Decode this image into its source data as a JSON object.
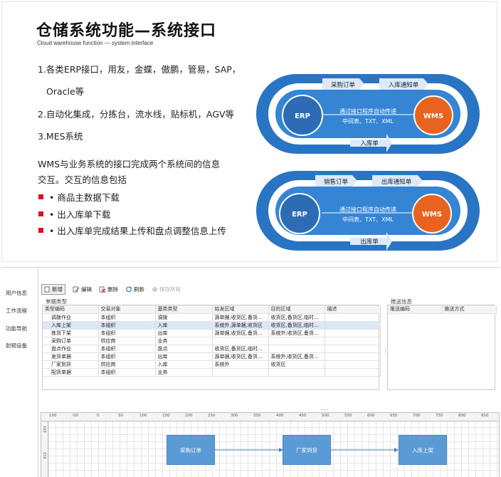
{
  "slide": {
    "title": "仓储系统功能—系统接口",
    "subtitle": "Cloud warehouse function — system interface",
    "lines": [
      "1.各类ERP接口，用友，金蝶，傲鹏，管易，SAP，",
      "Oracle等",
      "2.自动化集成，分拣台，流水线，贴标机，AGV等",
      "3.MES系统",
      "WMS与业务系统的接口完成两个系统间的信息",
      "交互。交互的信息包括"
    ],
    "bullets": [
      "• 商品主数据下载",
      "• 出入库单下载",
      "• 出入库单完成结果上传和盘点调整信息上传"
    ],
    "accent": "#d9121d",
    "diagram1": {
      "top_left": "采购订单",
      "top_right": "入库通知单",
      "left": "ERP",
      "right": "WMS",
      "mid1": "通过接口程序自动传递",
      "mid2": "中间表、TXT、XML",
      "bottom": "入库单"
    },
    "diagram2": {
      "top_left": "销售订单",
      "top_right": "出库通知单",
      "left": "ERP",
      "right": "WMS",
      "mid1": "通过接口程序自动传递",
      "mid2": "中间表、TXT、XML",
      "bottom": "出库单"
    }
  },
  "sidebar": {
    "items": [
      "用户信息",
      "工作流程",
      "功能导航",
      "射频设备"
    ]
  },
  "toolbar": {
    "new": "新增",
    "edit": "编辑",
    "delete": "删除",
    "refresh": "刷新",
    "save_all": "保存所有"
  },
  "panels": {
    "business_type": "单据类型",
    "push_info": "推送信息"
  },
  "table": {
    "headers": [
      "类型编码",
      "交易对象",
      "基类类型",
      "始发区域",
      "目的区域",
      "描述"
    ],
    "rows": [
      [
        "调拨作业",
        "本组织",
        "调拨",
        "源单据,收货区,备货...",
        "收货区,备货区,临时...",
        ""
      ],
      [
        "入库上架",
        "本组织",
        "入库",
        "系统外,源单据,收货区",
        "收货区,备货区,临时...",
        ""
      ],
      [
        "拣货下架",
        "本组织",
        "出库",
        "源单据,收货区,备货...",
        "系统外,收货区,备货...",
        ""
      ],
      [
        "采购订单",
        "供应商",
        "业务",
        "",
        "",
        ""
      ],
      [
        "盘点作业",
        "本组织",
        "盘点",
        "收货区,备货区,临时...",
        "",
        ""
      ],
      [
        "发货单据",
        "本组织",
        "出库",
        "源单据,收货区,备货...",
        "系统外,收货区,备货...",
        ""
      ],
      [
        "厂家到货",
        "供应商",
        "入库",
        "系统外",
        "收货区",
        ""
      ],
      [
        "配货单据",
        "本组织",
        "业务",
        "",
        "",
        ""
      ]
    ]
  },
  "right_table": {
    "headers": [
      "推送编码",
      "推送方式"
    ]
  },
  "ruler": {
    "marks": [
      "100",
      "-50",
      "0",
      "50",
      "100",
      "150",
      "200",
      "250",
      "300",
      "350",
      "400",
      "450",
      "500",
      "550",
      "600",
      "650",
      "700",
      "750",
      "800",
      "850"
    ],
    "left_marks": [
      "100",
      "150"
    ]
  },
  "flow": {
    "nodes": [
      "采购订单",
      "厂家到货",
      "入库上架"
    ]
  },
  "colors": {
    "diagram_blue": "#2a74c4",
    "erp": "#2d6cb5",
    "wms": "#e8641e",
    "node": "#5b9bd5"
  }
}
